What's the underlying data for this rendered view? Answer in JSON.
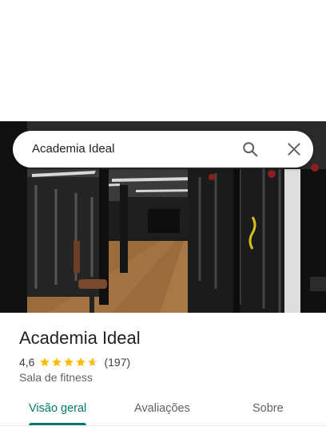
{
  "search": {
    "query": "Academia Ideal"
  },
  "place": {
    "name": "Academia Ideal",
    "rating": "4,6",
    "stars": 4.6,
    "reviews_count": "(197)",
    "category": "Sala de fitness"
  },
  "tabs": [
    {
      "label": "Visão geral",
      "active": true
    },
    {
      "label": "Avaliações",
      "active": false
    },
    {
      "label": "Sobre",
      "active": false
    }
  ],
  "colors": {
    "accent": "#00796b",
    "star": "#fbbc04"
  },
  "icons": {
    "search": "search-icon",
    "close": "close-icon"
  }
}
